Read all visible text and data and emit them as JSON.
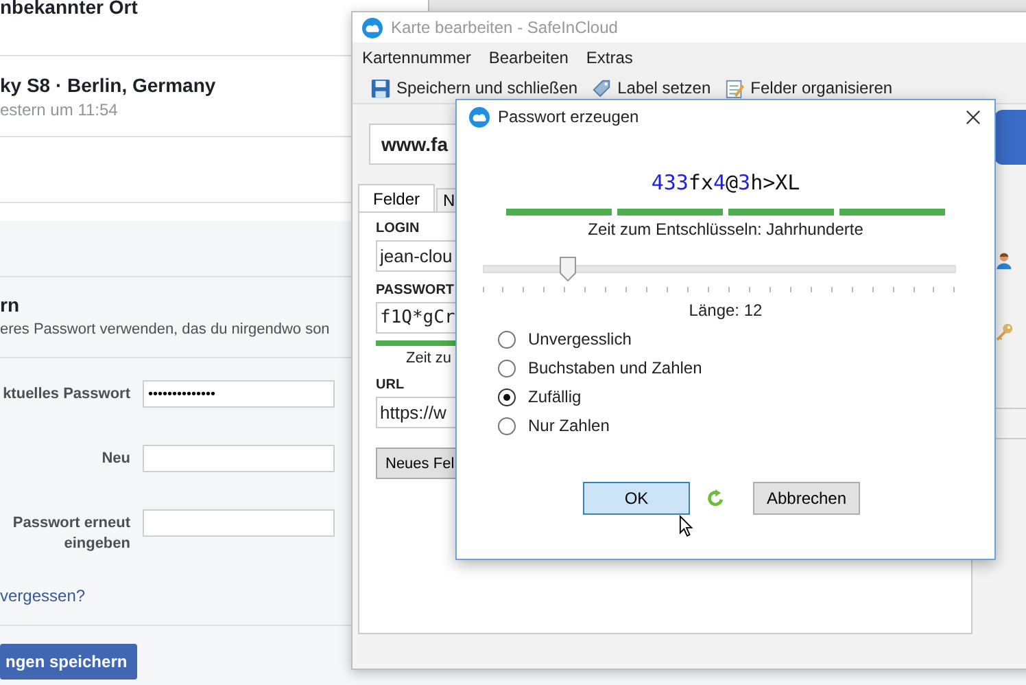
{
  "background_page": {
    "location": "nbekannter Ort",
    "session": {
      "device": "ky S8 · Berlin, Germany",
      "time": "estern um 11:54"
    },
    "section": {
      "title": "rn",
      "description": "eres Passwort verwenden, das du nirgendwo son"
    },
    "fields": [
      {
        "label": "ktuelles Passwort",
        "value": "••••••••••••••"
      },
      {
        "label": "Neu"
      },
      {
        "label": "Passwort erneut eingeben"
      }
    ],
    "link": "vergessen?",
    "button": "ngen speichern"
  },
  "card_window": {
    "title": "Karte bearbeiten - SafeInCloud",
    "menu": [
      "Kartennummer",
      "Bearbeiten",
      "Extras"
    ],
    "toolbar": [
      {
        "label": "Speichern und schließen",
        "kind": "save"
      },
      {
        "label": "Label setzen",
        "kind": "label"
      },
      {
        "label": "Felder organisieren",
        "kind": "organize"
      }
    ],
    "card_title": "www.fa",
    "tabs": [
      {
        "label": "Felder",
        "selected": true
      },
      {
        "label": "N",
        "selected": false
      }
    ],
    "fields": [
      {
        "label": "LOGIN",
        "value": "jean-clou",
        "kind": "text"
      },
      {
        "label": "PASSWORT",
        "value": "f1Q*gCr",
        "kind": "password",
        "hint": "Zeit zu"
      },
      {
        "label": "URL",
        "value": "https://w",
        "kind": "text"
      }
    ],
    "add_button": "Neues Fel"
  },
  "dialog": {
    "title": "Passwort erzeugen",
    "password": "433fx4@3h>XL",
    "strength": {
      "level": 1,
      "text": "Zeit zum Entschlüsseln: Jahrhunderte"
    },
    "length_slider": {
      "level": 0.18
    },
    "length_label": "Länge: 12",
    "options": [
      {
        "label": "Unvergesslich",
        "selected": false
      },
      {
        "label": "Buchstaben und Zahlen",
        "selected": false
      },
      {
        "label": "Zufällig",
        "selected": true
      },
      {
        "label": "Nur Zahlen",
        "selected": false
      }
    ],
    "buttons": {
      "ok": "OK",
      "cancel": "Abbrechen"
    }
  }
}
